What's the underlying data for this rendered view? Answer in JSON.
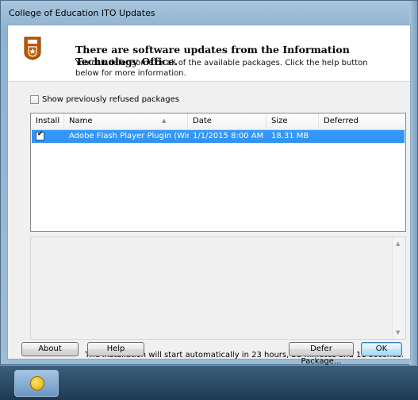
{
  "window": {
    "title": "College of Education ITO Updates"
  },
  "header": {
    "headline": "There are software updates from the Information Technology Office.",
    "subtext": "You can defer some or all of the available packages. Click the help button below for more information."
  },
  "options": {
    "show_refused_label": "Show previously refused packages"
  },
  "table": {
    "columns": {
      "install": "Install",
      "name": "Name",
      "date": "Date",
      "size": "Size",
      "deferred": "Deferred"
    },
    "rows": [
      {
        "name": "Adobe Flash Player Plugin (Win, In...",
        "date": "1/1/2015 8:00 AM",
        "size": "18.31 MB",
        "deferred": ""
      }
    ]
  },
  "status": {
    "notice": "The installation will start automatically in 23 hours, 58 minutes and 11 seconds."
  },
  "buttons": {
    "about": "About",
    "help": "Help",
    "defer": "Defer Package...",
    "ok": "OK"
  },
  "colors": {
    "selection": "#3399ff",
    "accent": "#3c7fb1",
    "logo": "#bf5700"
  },
  "icons": {
    "logo": "ut-seal-icon",
    "sort": "sort-up-icon",
    "taskbar_app": "update-app-icon"
  }
}
